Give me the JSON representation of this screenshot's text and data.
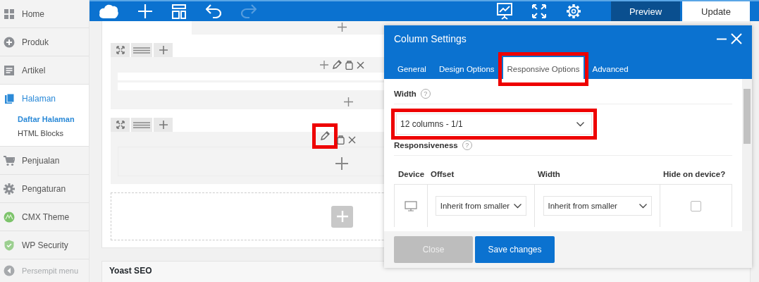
{
  "sidebar": {
    "items": [
      {
        "label": "Home",
        "selected": false
      },
      {
        "label": "Produk",
        "selected": false
      },
      {
        "label": "Artikel",
        "selected": false
      },
      {
        "label": "Halaman",
        "selected": true,
        "children": [
          {
            "label": "Daftar Halaman",
            "selected": true
          },
          {
            "label": "HTML Blocks",
            "selected": false
          }
        ]
      },
      {
        "label": "Penjualan",
        "selected": false
      },
      {
        "label": "Pengaturan",
        "selected": false
      },
      {
        "label": "CMX Theme",
        "selected": false
      },
      {
        "label": "WP Security",
        "selected": false
      }
    ],
    "collapse_label": "Persempit menu"
  },
  "toolbar": {
    "redo_disabled": true,
    "preview_label": "Preview",
    "update_label": "Update"
  },
  "editor": {
    "rows": [
      {
        "edit_highlighted": false
      },
      {
        "edit_highlighted": true
      }
    ]
  },
  "yoast": {
    "title": "Yoast SEO"
  },
  "modal": {
    "title": "Column Settings",
    "tabs": [
      {
        "label": "General",
        "selected": false,
        "highlighted": false
      },
      {
        "label": "Design Options",
        "selected": false,
        "highlighted": false
      },
      {
        "label": "Responsive Options",
        "selected": true,
        "highlighted": true
      },
      {
        "label": "Advanced",
        "selected": false,
        "highlighted": false
      }
    ],
    "width_label": "Width",
    "width_help": "?",
    "width_value": "12 columns - 1/1",
    "width_highlighted": true,
    "responsiveness_label": "Responsiveness",
    "responsiveness_help": "?",
    "columns": [
      "Device",
      "Offset",
      "Width",
      "Hide on device?"
    ],
    "rows": [
      {
        "offset": "Inherit from smaller",
        "width": "Inherit from smaller",
        "hidden": false
      }
    ],
    "close_label": "Close",
    "save_label": "Save changes"
  }
}
